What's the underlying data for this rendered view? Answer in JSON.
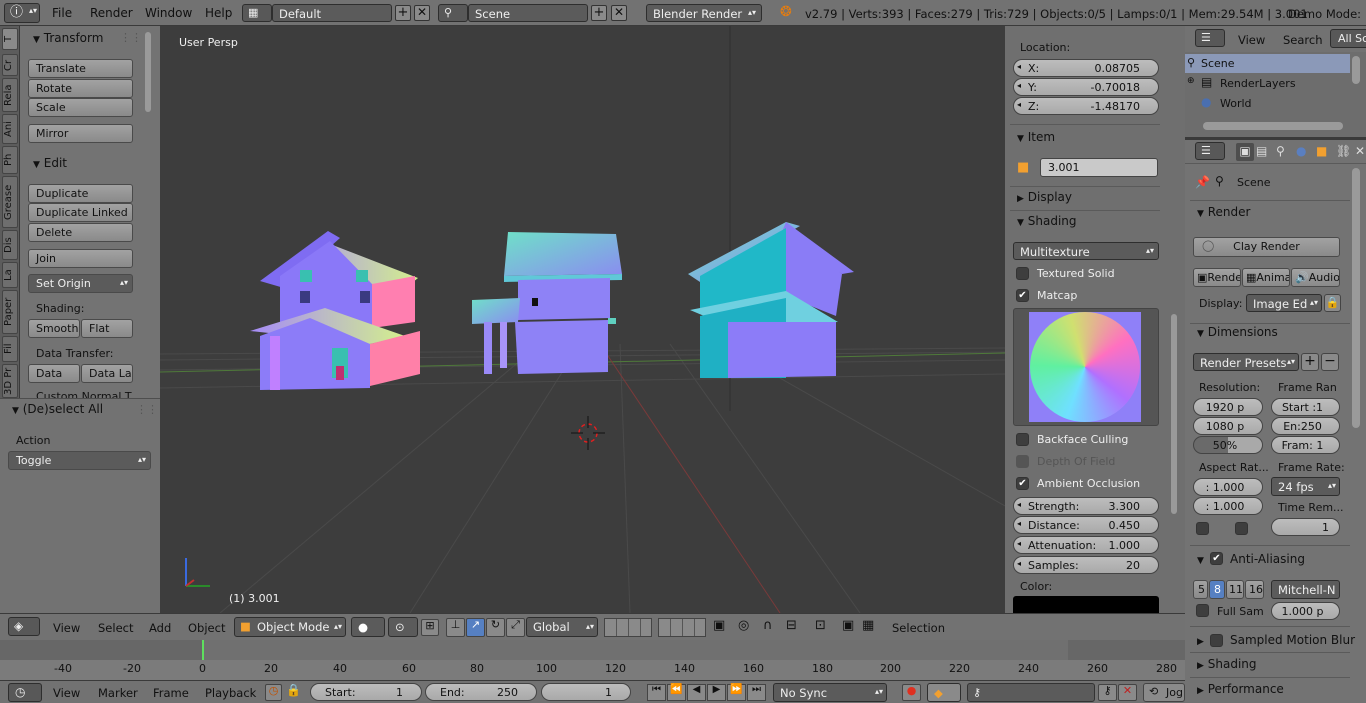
{
  "top_bar": {
    "menus": [
      "File",
      "Render",
      "Window",
      "Help"
    ],
    "layout": "Default",
    "scene": "Scene",
    "engine": "Blender Render",
    "stats": "v2.79 | Verts:393 | Faces:279 | Tris:729 | Objects:0/5 | Lamps:0/1 | Mem:29.54M | 3.001",
    "demo_mode": "Demo Mode:"
  },
  "tool_tabs": [
    "T",
    "Cr",
    "Rela",
    "Ani",
    "Ph",
    "Grease",
    "Dis",
    "La",
    "Paper",
    "Fil",
    "3D Pr"
  ],
  "tool_shelf": {
    "transform_header": "Transform",
    "transform_buttons": [
      "Translate",
      "Rotate",
      "Scale"
    ],
    "mirror": "Mirror",
    "edit_header": "Edit",
    "edit_buttons": [
      "Duplicate",
      "Duplicate Linked",
      "Delete"
    ],
    "join": "Join",
    "set_origin": "Set Origin",
    "shading_label": "Shading:",
    "smooth": "Smooth",
    "flat": "Flat",
    "data_transfer_label": "Data Transfer:",
    "data": "Data",
    "data_la": "Data La",
    "cutoff": "Custom Normal T",
    "operator_header": "(De)select All",
    "action_label": "Action",
    "action_value": "Toggle"
  },
  "viewport": {
    "view_name": "User Persp",
    "object_info": "(1) 3.001"
  },
  "n_panel": {
    "location_label": "Location:",
    "x_label": "X:",
    "x": "0.08705",
    "y_label": "Y:",
    "y": "-0.70018",
    "z_label": "Z:",
    "z": "-1.48170",
    "item_header": "Item",
    "item_name": "3.001",
    "display_header": "Display",
    "shading_header": "Shading",
    "shading_mode": "Multitexture",
    "textured_solid": "Textured Solid",
    "matcap": "Matcap",
    "backface": "Backface Culling",
    "dof": "Depth Of Field",
    "ao": "Ambient Occlusion",
    "strength_label": "Strength:",
    "strength": "3.300",
    "distance_label": "Distance:",
    "distance": "0.450",
    "attenuation_label": "Attenuation:",
    "attenuation": "1.000",
    "samples_label": "Samples:",
    "samples": "20",
    "color_label": "Color:"
  },
  "outliner": {
    "view": "View",
    "search": "Search",
    "filter": "All Sc",
    "items": [
      "Scene",
      "RenderLayers",
      "World"
    ]
  },
  "properties": {
    "scene_label": "Scene",
    "render_header": "Render",
    "clay_render": "Clay Render",
    "render_tabs": [
      "Rende",
      "Anima",
      "Audio"
    ],
    "display_label": "Display:",
    "display_value": "Image Ed",
    "dimensions_header": "Dimensions",
    "render_presets": "Render Presets",
    "resolution_label": "Resolution:",
    "frame_range_label": "Frame Ran",
    "res_x": "1920 p",
    "res_y": "1080 p",
    "res_pct": "50%",
    "frame_start": "Start :1",
    "frame_end": "En:250",
    "frame_step": "Fram: 1",
    "aspect_label": "Aspect Rat...",
    "frame_rate_label": "Frame Rate:",
    "aspect_x": ": 1.000",
    "aspect_y": ": 1.000",
    "fps": "24 fps",
    "time_rem": "Time Rem...",
    "time_val": "1",
    "aa_header": "Anti-Aliasing",
    "aa_samples": [
      "5",
      "8",
      "11",
      "16"
    ],
    "aa_filter": "Mitchell-N",
    "full_sample": "Full Sam",
    "filter_size": "1.000 p",
    "motion_blur": "Sampled Motion Blur",
    "shading_header": "Shading",
    "performance_header": "Performance"
  },
  "view_header": {
    "menus": [
      "View",
      "Select",
      "Add",
      "Object"
    ],
    "mode": "Object Mode",
    "orientation": "Global",
    "selection": "Selection"
  },
  "timeline": {
    "ticks": [
      "-40",
      "-20",
      "0",
      "20",
      "40",
      "60",
      "80",
      "100",
      "120",
      "140",
      "160",
      "180",
      "200",
      "220",
      "240",
      "260",
      "280"
    ],
    "menus": [
      "View",
      "Marker",
      "Frame",
      "Playback"
    ],
    "start_label": "Start:",
    "start": "1",
    "end_label": "End:",
    "end": "250",
    "current": "1",
    "sync": "No Sync",
    "keying": "Jog"
  },
  "colors": {
    "accent_blue": "#5680c2",
    "viewport_bg": "#3d3d3d",
    "panel_bg": "#737373"
  }
}
